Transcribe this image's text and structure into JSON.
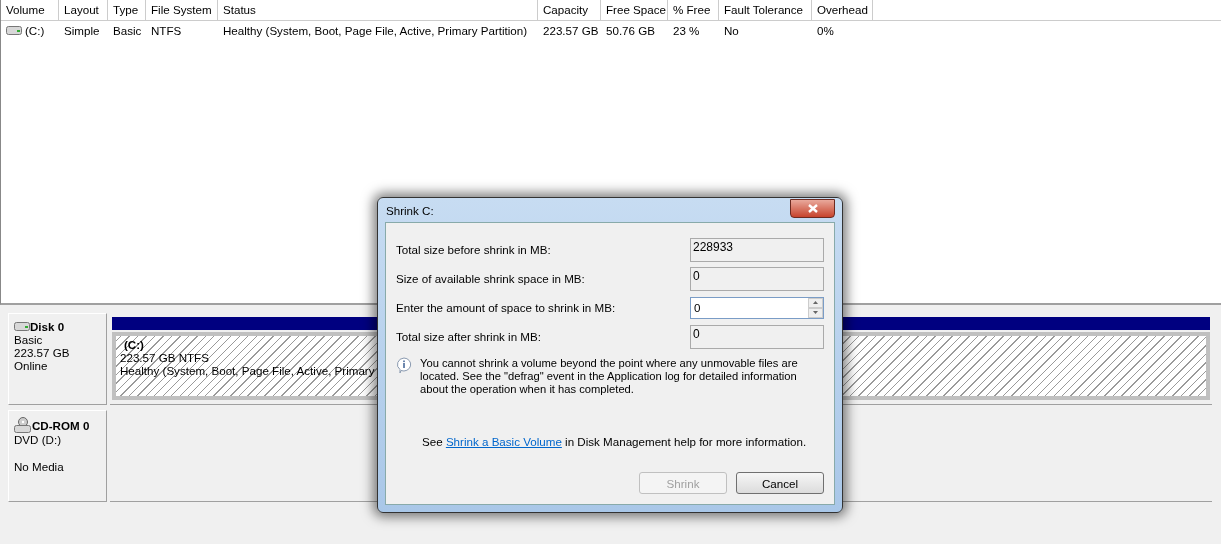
{
  "volume_list": {
    "columns": [
      "Volume",
      "Layout",
      "Type",
      "File System",
      "Status",
      "Capacity",
      "Free Space",
      "% Free",
      "Fault Tolerance",
      "Overhead"
    ],
    "rows": [
      {
        "cells": [
          "(C:)",
          "Simple",
          "Basic",
          "NTFS",
          "Healthy (System, Boot, Page File, Active, Primary Partition)",
          "223.57 GB",
          "50.76 GB",
          "23 %",
          "No",
          "0%"
        ]
      }
    ]
  },
  "disks": [
    {
      "kind": "disk",
      "name": "Disk 0",
      "type": "Basic",
      "size": "223.57 GB",
      "status": "Online",
      "partition": {
        "label": "(C:)",
        "size": "223.57 GB NTFS",
        "status": "Healthy (System, Boot, Page File, Active, Primary"
      }
    },
    {
      "kind": "cdrom",
      "name": "CD-ROM 0",
      "type": "DVD (D:)",
      "status": "No Media"
    }
  ],
  "dialog": {
    "title": "Shrink C:",
    "fields": [
      {
        "kind": "readonly",
        "label": "Total size before shrink in MB:",
        "value": "228933"
      },
      {
        "kind": "readonly",
        "label": "Size of available shrink space in MB:",
        "value": "0"
      },
      {
        "kind": "spin",
        "label": "Enter the amount of space to shrink in MB:",
        "value": "0"
      },
      {
        "kind": "readonly",
        "label": "Total size after shrink in MB:",
        "value": "0"
      }
    ],
    "note": "You cannot shrink a volume beyond the point where any unmovable files are located. See the \"defrag\" event in the Application log for detailed information about the operation when it has completed.",
    "help": {
      "before": "See",
      "link": "Shrink a Basic Volume",
      "after": "in Disk Management help for more information."
    },
    "buttons": [
      {
        "label": "Shrink",
        "disabled": true
      },
      {
        "label": "Cancel",
        "disabled": false
      }
    ]
  }
}
